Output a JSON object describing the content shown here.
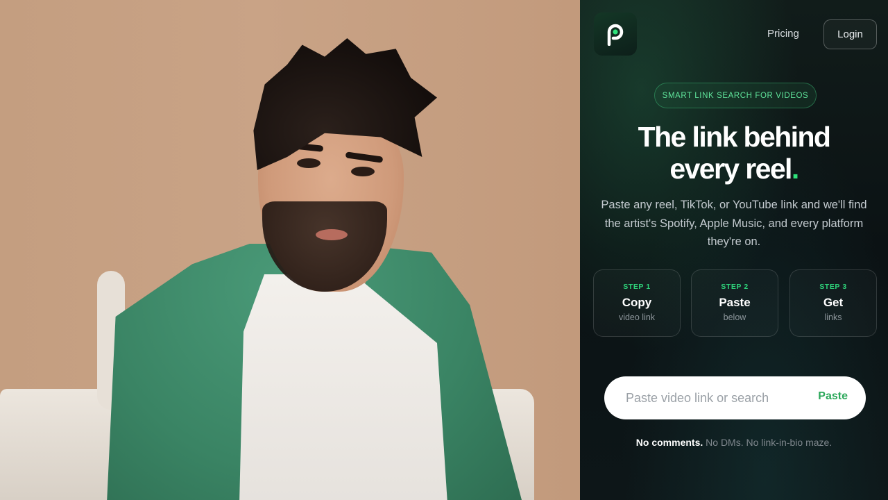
{
  "photo": {
    "description_icon": "person-photo"
  },
  "header": {
    "logo_icon": "p-logo-icon",
    "pricing_label": "Pricing",
    "login_label": "Login"
  },
  "hero": {
    "badge": "SMART LINK SEARCH FOR VIDEOS",
    "headline_line1": "The link behind",
    "headline_line2": "every reel",
    "headline_dot": ".",
    "subtitle": "Paste any reel, TikTok, or YouTube link and we'll find the artist's Spotify, Apple Music, and every platform they're on."
  },
  "steps": [
    {
      "label": "STEP 1",
      "title": "Copy",
      "desc": "video link"
    },
    {
      "label": "STEP 2",
      "title": "Paste",
      "desc": "below"
    },
    {
      "label": "STEP 3",
      "title": "Get",
      "desc": "links"
    }
  ],
  "search": {
    "placeholder": "Paste video link or search",
    "value": "",
    "paste_label": "Paste"
  },
  "footnote": {
    "strong": "No comments.",
    "rest": " No DMs. No link-in-bio maze."
  },
  "colors": {
    "accent": "#2ee27a",
    "panel_bg": "#0b1214",
    "badge_text": "#5fe39a"
  }
}
